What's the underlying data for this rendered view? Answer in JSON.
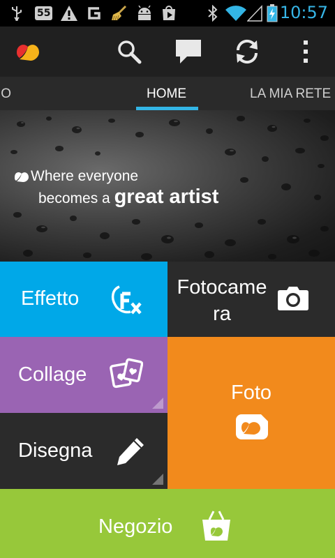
{
  "status_bar": {
    "badge_text": "55",
    "time": "10:57",
    "icons": [
      "usb-icon",
      "notification-count-badge",
      "warning-icon",
      "google-icon",
      "broom-icon",
      "android-icon",
      "play-store-icon",
      "bluetooth-icon",
      "wifi-icon",
      "signal-icon",
      "battery-charging-icon"
    ]
  },
  "action_bar": {
    "icons": [
      "app-logo-icon",
      "search-icon",
      "chat-icon",
      "refresh-icon",
      "overflow-menu-icon"
    ]
  },
  "tabs": [
    {
      "label": "IO",
      "active": false
    },
    {
      "label": "HOME",
      "active": true
    },
    {
      "label": "LA MIA RETE",
      "active": false
    }
  ],
  "banner": {
    "line1": "Where everyone",
    "line2_prefix": "becomes a",
    "line2_emphasis": "great artist"
  },
  "tiles": {
    "effect": {
      "label": "Effetto",
      "color": "#00a8e8",
      "icon": "fx-icon"
    },
    "camera": {
      "label_line1": "Fotocame",
      "label_line2": "ra",
      "color": "#2b2b2b",
      "icon": "camera-icon"
    },
    "collage": {
      "label": "Collage",
      "color": "#9a64b3",
      "icon": "collage-icon"
    },
    "photo": {
      "label": "Foto",
      "color": "#f28a1c",
      "icon": "photo-icon"
    },
    "draw": {
      "label": "Disegna",
      "color": "#2b2b2b",
      "icon": "pencil-icon"
    },
    "shop": {
      "label": "Negozio",
      "color": "#97c83a",
      "icon": "shopping-bag-icon"
    }
  }
}
